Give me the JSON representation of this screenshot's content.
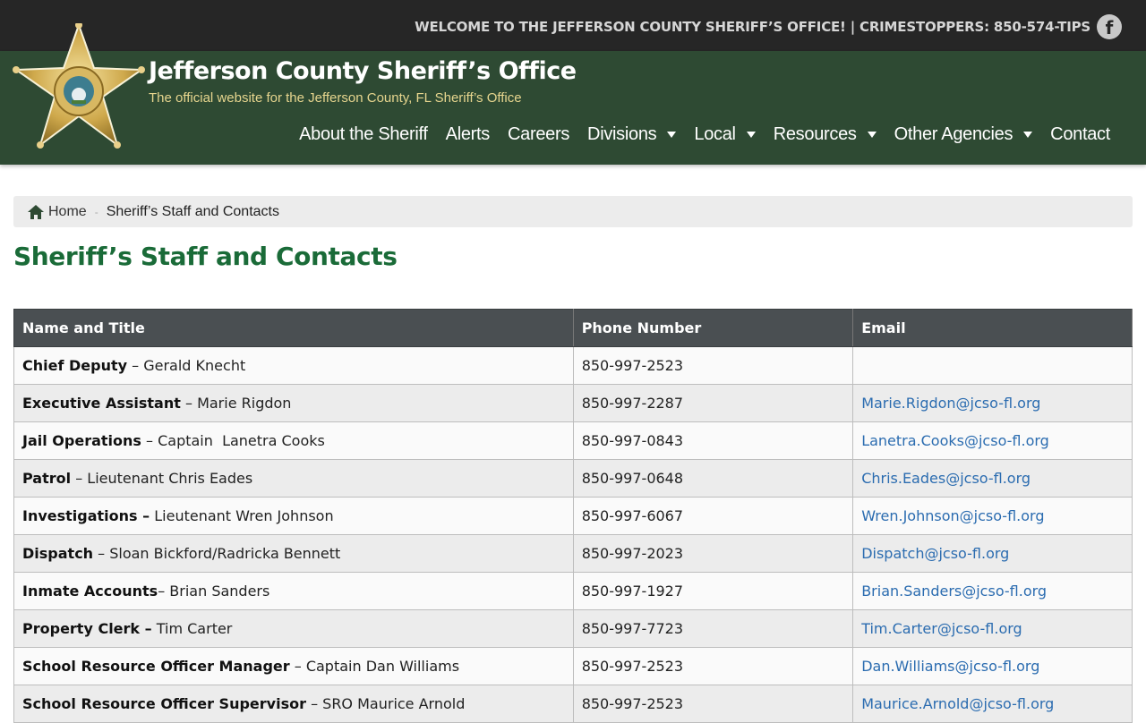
{
  "topbar": {
    "welcome": "WELCOME TO THE JEFFERSON COUNTY SHERIFF’S OFFICE! | CRIMESTOPPERS: 850-574-TIPS",
    "facebook_glyph": "f",
    "facebook_icon": "facebook-icon"
  },
  "header": {
    "title": "Jefferson County Sheriff’s Office",
    "tagline": "The official website for the Jefferson County, FL Sheriff’s Office",
    "badge_icon": "sheriff-star-badge"
  },
  "nav": {
    "items": [
      {
        "label": "About the Sheriff",
        "dropdown": false
      },
      {
        "label": "Alerts",
        "dropdown": false
      },
      {
        "label": "Careers",
        "dropdown": false
      },
      {
        "label": "Divisions",
        "dropdown": true
      },
      {
        "label": "Local",
        "dropdown": true
      },
      {
        "label": "Resources",
        "dropdown": true
      },
      {
        "label": "Other Agencies",
        "dropdown": true
      },
      {
        "label": "Contact",
        "dropdown": false
      }
    ]
  },
  "breadcrumb": {
    "home": "Home",
    "separator": "-",
    "current": "Sheriff’s Staff and Contacts"
  },
  "page": {
    "title": "Sheriff’s Staff and Contacts"
  },
  "table": {
    "headers": [
      "Name and Title",
      "Phone Number",
      "Email"
    ],
    "rows": [
      {
        "role": "Chief Deputy",
        "sep": " – ",
        "name": "Gerald Knecht",
        "phone": "850-997-2523",
        "email": ""
      },
      {
        "role": "Executive Assistant",
        "sep": " – ",
        "name": "Marie Rigdon",
        "phone": "850-997-2287",
        "email": "Marie.Rigdon@jcso-fl.org"
      },
      {
        "role": "Jail Operations",
        "sep": " – ",
        "name": "Captain  Lanetra Cooks",
        "phone": "850-997-0843",
        "email": "Lanetra.Cooks@jcso-fl.org"
      },
      {
        "role": "Patrol",
        "sep": " – ",
        "name": "Lieutenant Chris Eades",
        "phone": "850-997-0648",
        "email": "Chris.Eades@jcso-fl.org"
      },
      {
        "role": "Investigations –",
        "sep": " ",
        "name": "Lieutenant Wren Johnson",
        "phone": "850-997-6067",
        "email": "Wren.Johnson@jcso-fl.org"
      },
      {
        "role": "Dispatch",
        "sep": " – ",
        "name": "Sloan Bickford/Radricka Bennett",
        "phone": "850-997-2023",
        "email": "Dispatch@jcso-fl.org"
      },
      {
        "role": "Inmate Accounts",
        "sep": "– ",
        "name": "Brian Sanders",
        "phone": "850-997-1927",
        "email": "Brian.Sanders@jcso-fl.org"
      },
      {
        "role": "Property Clerk –",
        "sep": " ",
        "name": "Tim Carter",
        "phone": "850-997-7723",
        "email": "Tim.Carter@jcso-fl.org"
      },
      {
        "role": "School Resource Officer Manager",
        "sep": " – ",
        "name": "Captain Dan Williams",
        "phone": "850-997-2523",
        "email": "Dan.Williams@jcso-fl.org"
      },
      {
        "role": "School Resource Officer Supervisor",
        "sep": " – ",
        "name": "SRO Maurice Arnold",
        "phone": "850-997-2523",
        "email": "Maurice.Arnold@jcso-fl.org"
      }
    ]
  },
  "colors": {
    "topbar": "#262626",
    "header": "#2e4a33",
    "title_green": "#1a6b38",
    "link": "#2b6cb0",
    "table_header": "#4a4f52"
  }
}
